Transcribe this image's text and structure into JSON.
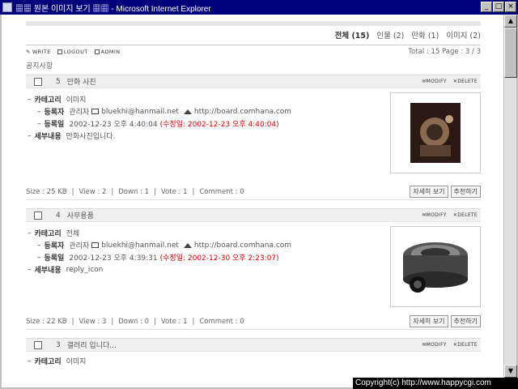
{
  "window": {
    "title": "▦▦ 원본 이미지 보기 ▦▦ - Microsoft Internet Explorer",
    "btn_min": "_",
    "btn_max": "□",
    "btn_close": "×"
  },
  "categories": [
    {
      "label": "전체 (15)",
      "active": true
    },
    {
      "label": "인물 (2)"
    },
    {
      "label": "만화 (1)"
    },
    {
      "label": "이미지 (2)"
    }
  ],
  "toolbar": {
    "write": "WRITE",
    "logout": "LOGOUT",
    "admin": "ADMIN",
    "total": "Total : 15   Page : 3 / 3"
  },
  "notice": "공지사항",
  "labels": {
    "category": "카테고리",
    "author": "등록자",
    "date": "등록일",
    "detail": "세부내용",
    "modify": "MODIFY",
    "delete": "DELETE",
    "view_btn": "자세히 보기",
    "recommend_btn": "추천하기",
    "dash": "–"
  },
  "posts": [
    {
      "num": "5",
      "title": "만화 사진",
      "category": "이미지",
      "author": "관리자",
      "email": "bluekhi@hanmail.net",
      "homepage": "http://board.comhana.com",
      "date": "2002-12-23 오후 4:40:04",
      "modified": "(수정일: 2002-12-23 오후 4:40:04)",
      "detail": "만화사진입니다.",
      "stats": {
        "size": "Size : 25 KB",
        "view": "View : 2",
        "down": "Down : 1",
        "vote": "Vote : 1",
        "comment": "Comment : 0"
      }
    },
    {
      "num": "4",
      "title": "사무용품",
      "category": "전체",
      "author": "관리자",
      "email": "bluekhi@hanmail.net",
      "homepage": "http://board.comhana.com",
      "date": "2002-12-23 오후 4:39:31",
      "modified": "(수정일: 2002-12-30 오후 2:23:07)",
      "detail": "reply_icon",
      "stats": {
        "size": "Size : 22 KB",
        "view": "View : 3",
        "down": "Down : 0",
        "vote": "Vote : 1",
        "comment": "Comment : 0"
      }
    },
    {
      "num": "3",
      "title": "갤러리 입니다...",
      "category": "이미지"
    }
  ],
  "footer": {
    "copyright": "Copyright(c) http://www.happycgi.com"
  }
}
